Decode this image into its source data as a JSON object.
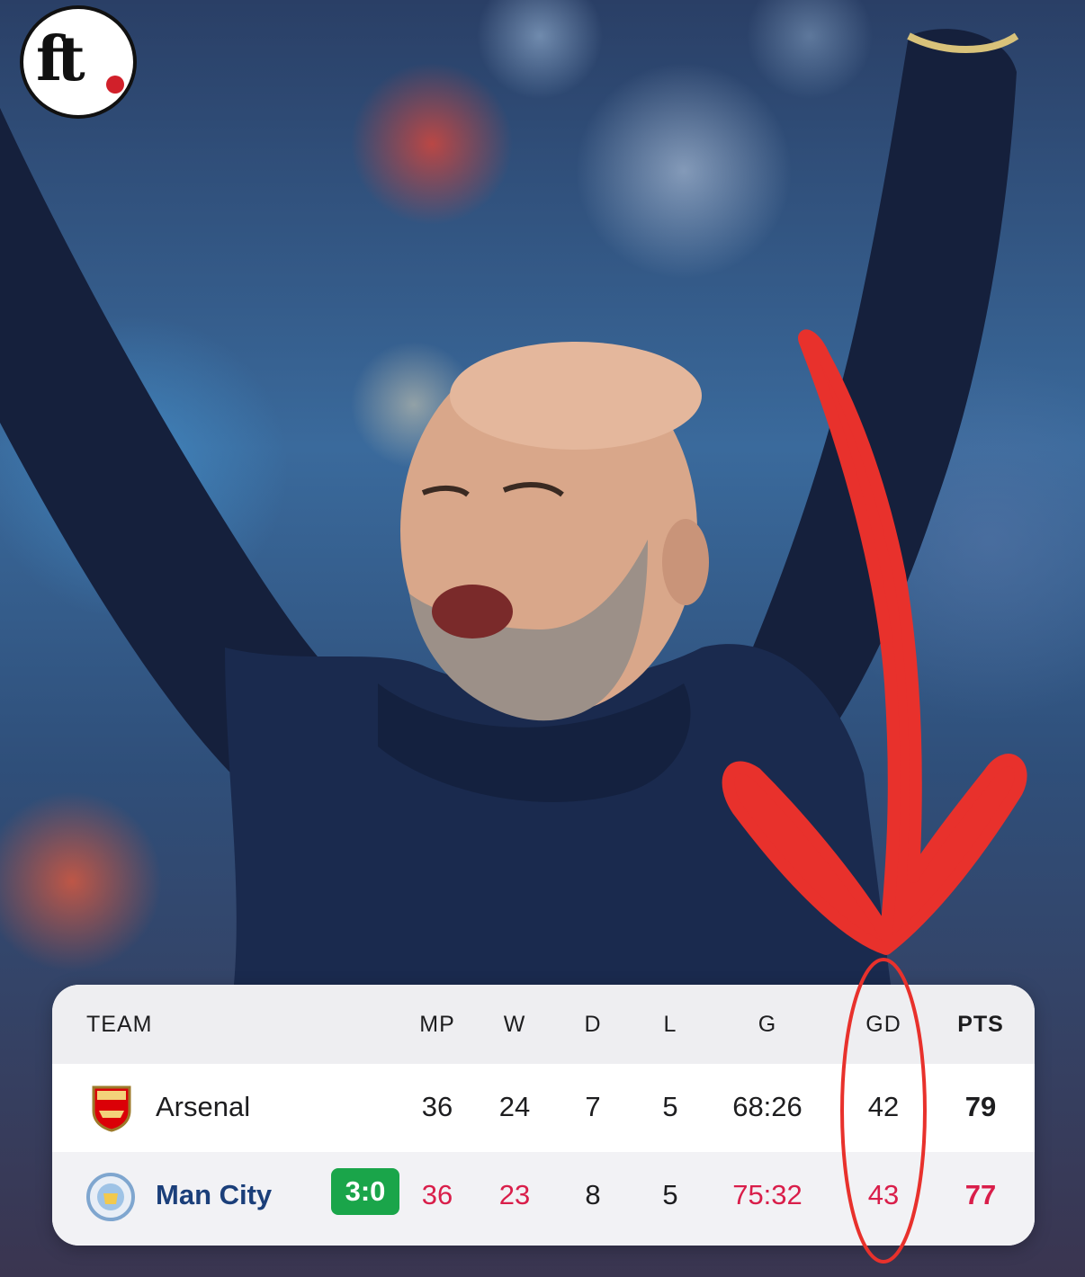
{
  "logo": {
    "text": "ft"
  },
  "table": {
    "headers": {
      "team": "TEAM",
      "mp": "MP",
      "w": "W",
      "d": "D",
      "l": "L",
      "g": "G",
      "gd": "GD",
      "pts": "PTS"
    },
    "rows": [
      {
        "team": "Arsenal",
        "mp": "36",
        "w": "24",
        "d": "7",
        "l": "5",
        "g": "68:26",
        "gd": "42",
        "pts": "79",
        "highlight": false
      },
      {
        "team": "Man City",
        "result": "3:0",
        "mp": "36",
        "w": "23",
        "d": "8",
        "l": "5",
        "g": "75:32",
        "gd": "43",
        "pts": "77",
        "highlight": true
      }
    ]
  },
  "colors": {
    "arrow": "#e8312c",
    "win_badge": "#1aa54a",
    "changed_value": "#d91e4a",
    "city_text": "#1b3f7a"
  }
}
